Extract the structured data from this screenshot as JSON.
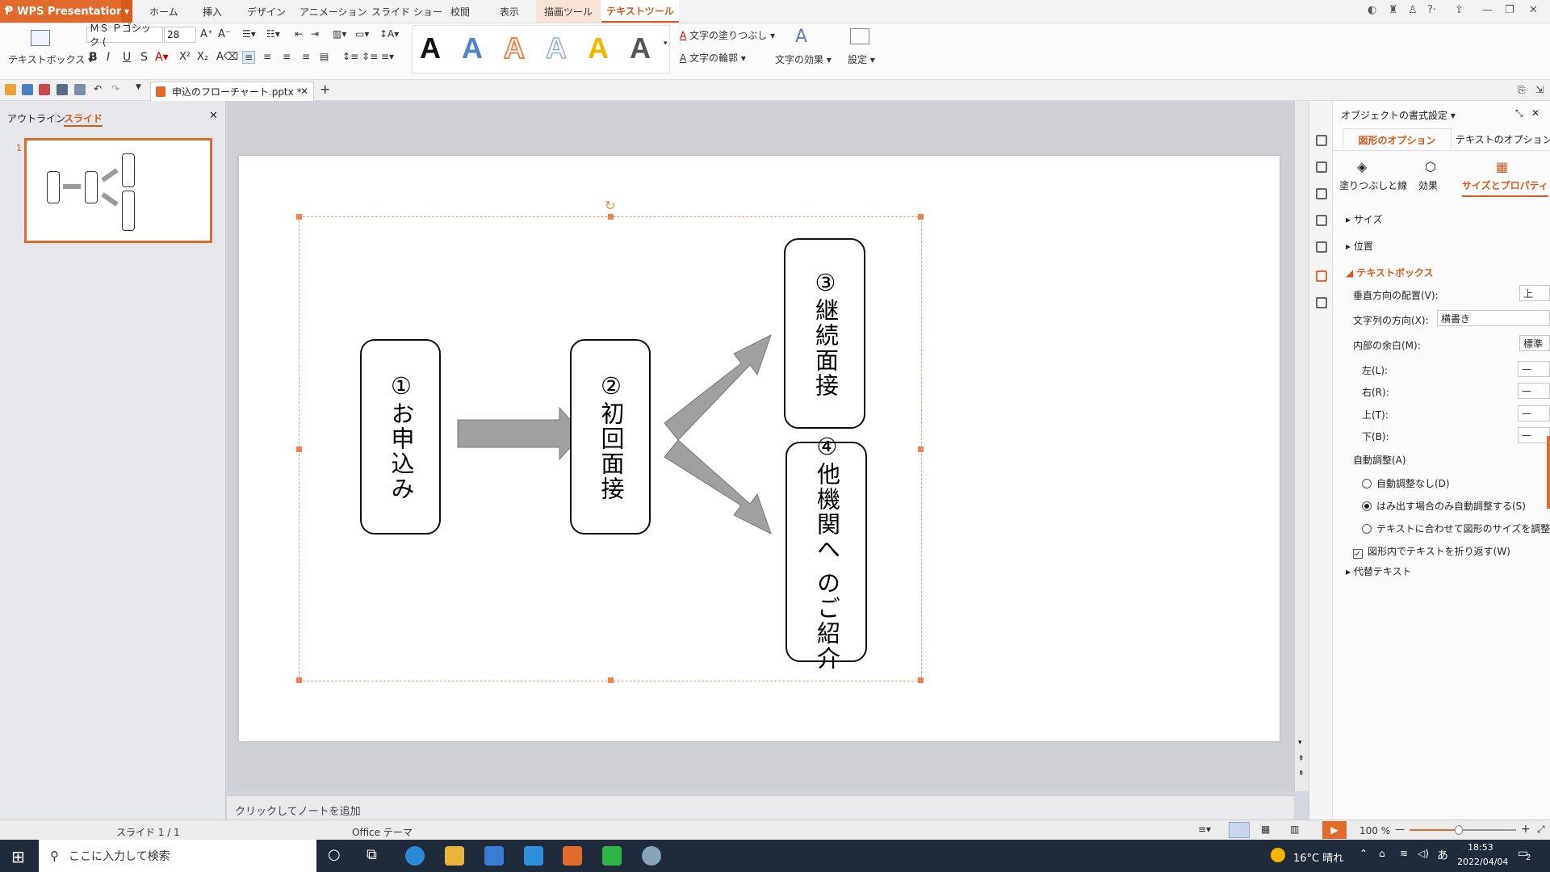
{
  "app": {
    "name": "WPS Presentation",
    "menu": [
      "ホーム",
      "挿入",
      "デザイン",
      "アニメーション",
      "スライド ショー",
      "校閲",
      "表示"
    ],
    "context_tabs": [
      "描画ツール",
      "テキストツール"
    ]
  },
  "ribbon": {
    "textbox_label": "テキストボックス",
    "font_name": "ＭＳ Ｐゴシック (",
    "font_size": "28",
    "fill_label": "文字の塗りつぶし",
    "outline_label": "文字の輪郭",
    "effect_label": "文字の効果",
    "settings_label": "設定",
    "style_colors": [
      "#111111",
      "#4a86c8",
      "#e8874a",
      "#8fb0d8",
      "#f2b600",
      "#555555"
    ]
  },
  "doc_tab": {
    "title": "申込のフローチャート.pptx *"
  },
  "left_pane": {
    "tab_outline": "アウトライン",
    "tab_slide": "スライド",
    "slide_number": "1"
  },
  "slide": {
    "boxes": [
      "①お申込み",
      "②初回面接",
      "③継続面接",
      "④他機関へ のご紹介"
    ]
  },
  "notes_placeholder": "クリックしてノートを追加",
  "panel": {
    "title": "オブジェクトの書式設定",
    "tabs": [
      "図形のオプション",
      "テキストのオプション"
    ],
    "subtabs": [
      "塗りつぶしと線",
      "効果",
      "サイズとプロパティ"
    ],
    "sections": {
      "size": "サイズ",
      "position": "位置",
      "textbox": "テキストボックス",
      "alt_text": "代替テキスト"
    },
    "vertical_align_label": "垂直方向の配置(V):",
    "vertical_align_value": "上",
    "text_direction_label": "文字列の方向(X):",
    "text_direction_value": "横書き",
    "margin_label": "内部の余白(M):",
    "margin_value": "標準",
    "margin_left": "左(L):",
    "margin_right": "右(R):",
    "margin_top": "上(T):",
    "margin_bottom": "下(B):",
    "autofit_label": "自動調整(A)",
    "autofit_options": [
      "自動調整なし(D)",
      "はみ出す場合のみ自動調整する(S)",
      "テキストに合わせて図形のサイズを調整する"
    ],
    "wrap_label": "図形内でテキストを折り返す(W)"
  },
  "status": {
    "slide_info": "スライド 1 / 1",
    "theme": "Office テーマ",
    "zoom": "100 %"
  },
  "taskbar": {
    "search_placeholder": "ここに入力して検索",
    "weather": "16°C 晴れ",
    "ime": "あ",
    "time": "18:53",
    "date": "2022/04/04",
    "notifications": "2"
  }
}
